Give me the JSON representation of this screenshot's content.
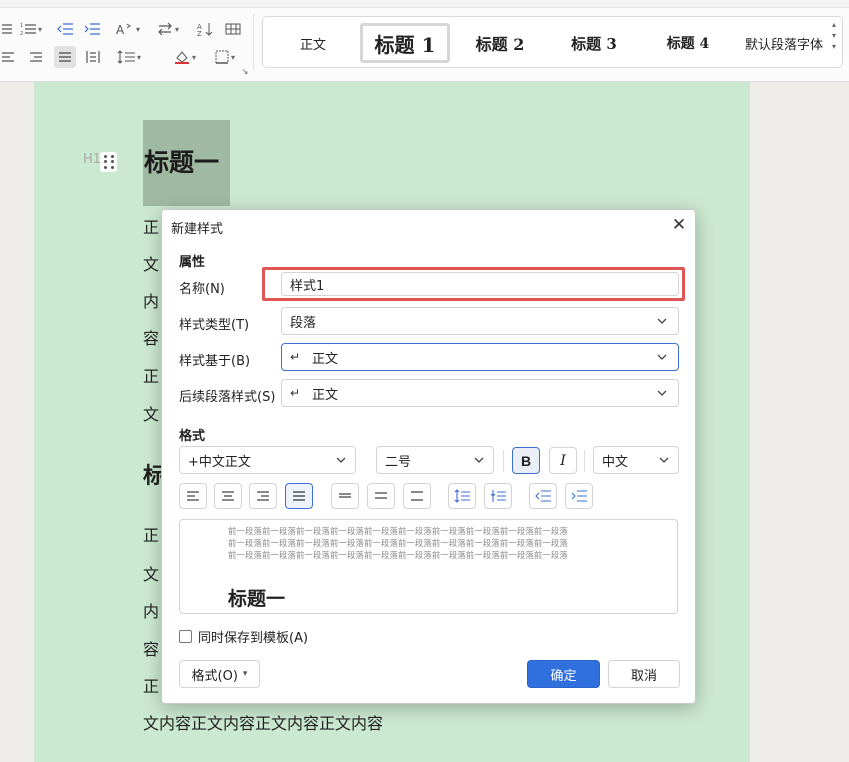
{
  "ribbon": {
    "style_gallery": [
      {
        "label": "正文",
        "size": "13px",
        "weight": "normal"
      },
      {
        "label": "标题 1",
        "size": "20px",
        "weight": "bold"
      },
      {
        "label": "标题 2",
        "size": "16px",
        "weight": "bold"
      },
      {
        "label": "标题 3",
        "size": "15px",
        "weight": "bold"
      },
      {
        "label": "标题 4",
        "size": "14px",
        "weight": "bold"
      },
      {
        "label": "默认段落字体",
        "size": "13px",
        "weight": "normal"
      }
    ]
  },
  "document": {
    "heading1": "标题一",
    "heading_marker": "H1",
    "heading2_partial": "标",
    "body_lines": [
      "正",
      "文",
      "内",
      "容",
      "正",
      "文"
    ],
    "body_lines_2": [
      "正",
      "文",
      "内",
      "容",
      "正"
    ],
    "last_line": "文内容正文内容正文内容正文内容"
  },
  "dialog": {
    "title": "新建样式",
    "close_glyph": "✕",
    "section_properties": "属性",
    "name_label": "名称(N)",
    "name_value": "样式1",
    "type_label": "样式类型(T)",
    "type_value": "段落",
    "based_on_label": "样式基于(B)",
    "based_on_value": "正文",
    "next_label": "后续段落样式(S)",
    "next_value": "正文",
    "return_glyph": "↵",
    "section_format": "格式",
    "font_value": "+中文正文",
    "size_value": "二号",
    "bold_label": "B",
    "italic_label": "I",
    "lang_value": "中文",
    "preview_lines": [
      "前一段落前一段落前一段落前一段落前一段落前一段落前一段落前一段落前一段落前一段落",
      "前一段落前一段落前一段落前一段落前一段落前一段落前一段落前一段落前一段落前一段落",
      "前一段落前一段落前一段落前一段落前一段落前一段落前一段落前一段落前一段落前一段落"
    ],
    "preview_heading": "标题一",
    "save_template_label": "同时保存到模板(A)",
    "format_button": "格式(O)",
    "ok_button": "确定",
    "cancel_button": "取消"
  },
  "colors": {
    "page_bg": "#cbe8d0",
    "heading_highlight": "#9fb9a2",
    "accent_blue": "#2f6fde",
    "name_highlight_red": "#e05555"
  },
  "icons": [
    "bullet-list-icon",
    "numbered-list-icon",
    "outdent-icon",
    "indent-icon",
    "text-direction-icon",
    "line-sort-icon",
    "sort-icon",
    "table-icon",
    "align-left-icon",
    "align-center-icon",
    "align-right-icon",
    "justify-icon",
    "distributed-icon",
    "line-spacing-icon",
    "shading-icon",
    "border-icon",
    "close-icon",
    "chevron-down-icon",
    "drag-handle-icon"
  ]
}
